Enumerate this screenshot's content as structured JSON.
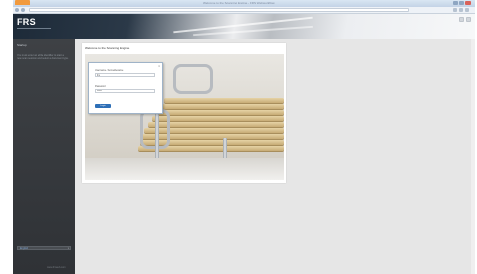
{
  "browser": {
    "window_title": "Welcome to the Scanning Engine - FRS Webworkflow",
    "address": ""
  },
  "app": {
    "logo": "FRS"
  },
  "sidebar": {
    "title": "Startup",
    "description": "You must enter an eFile identifier to start a new scan session and select a document type.",
    "select_label": "English",
    "footer": "www.frsweb.com"
  },
  "main": {
    "panel_title": "Welcome to the Scanning Engine",
    "login": {
      "close": "×",
      "username_label": "Username / Anmeldename",
      "username_value": "fra",
      "password_label": "Password",
      "password_value": "*****",
      "submit_label": "Login"
    }
  },
  "colors": {
    "accent": "#2e6fb7",
    "sidebar_bg": "#3a3d41",
    "tab_orange": "#f19a3e"
  }
}
